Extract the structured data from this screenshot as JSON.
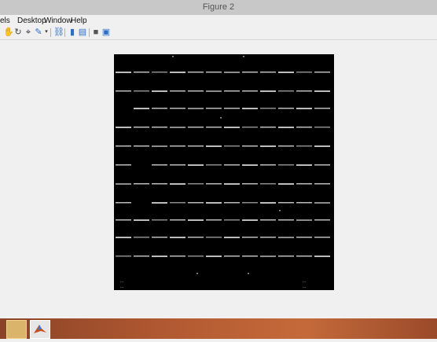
{
  "window": {
    "title": "Figure 2"
  },
  "menu": {
    "items": [
      "els",
      "Desktop",
      "Window",
      "Help"
    ]
  },
  "toolbar": {
    "icons": [
      "pan-icon",
      "rotate-icon",
      "data-cursor-icon",
      "brush-icon",
      "dropdown-arrow-icon",
      "link-plot-icon",
      "colorbar-icon",
      "legend-icon",
      "hide-plot-tools-icon",
      "show-plot-tools-icon"
    ]
  },
  "figure": {
    "background": "#000000",
    "corner_text": {
      "left": [
        "...",
        "..."
      ],
      "right": [
        "...",
        "..."
      ]
    }
  },
  "taskbar": {
    "apps": [
      "file-explorer-icon",
      "matlab-icon"
    ]
  }
}
